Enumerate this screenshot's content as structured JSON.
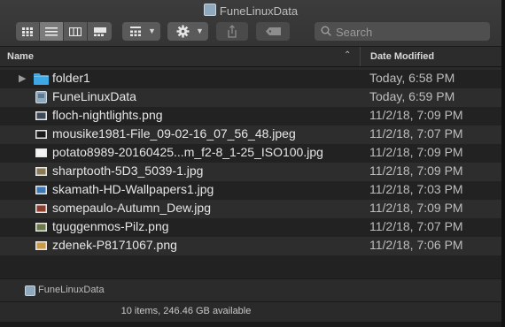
{
  "window": {
    "title": "FuneLinuxData"
  },
  "toolbar": {
    "view_modes": [
      "icon-view",
      "list-view",
      "column-view",
      "gallery-view"
    ],
    "active_view": "list-view",
    "group_menu_icon": "group-grid-icon",
    "action_menu_icon": "gear-icon",
    "share_icon": "share-icon",
    "tag_icon": "tag-icon",
    "search_placeholder": "Search"
  },
  "columns": {
    "name": "Name",
    "date": "Date Modified"
  },
  "files": [
    {
      "name": "folder1",
      "date": "Today, 6:58 PM",
      "kind": "folder"
    },
    {
      "name": "FuneLinuxData",
      "date": "Today, 6:59 PM",
      "kind": "app"
    },
    {
      "name": "floch-nightlights.png",
      "date": "11/2/18, 7:09 PM",
      "kind": "image"
    },
    {
      "name": "mousike1981-File_09-02-16_07_56_48.jpeg",
      "date": "11/2/18, 7:07 PM",
      "kind": "image"
    },
    {
      "name": "potato8989-20160425...m_f2-8_1-25_ISO100.jpg",
      "date": "11/2/18, 7:09 PM",
      "kind": "image"
    },
    {
      "name": "sharptooth-5D3_5039-1.jpg",
      "date": "11/2/18, 7:09 PM",
      "kind": "image"
    },
    {
      "name": "skamath-HD-Wallpapers1.jpg",
      "date": "11/2/18, 7:03 PM",
      "kind": "image"
    },
    {
      "name": "somepaulo-Autumn_Dew.jpg",
      "date": "11/2/18, 7:09 PM",
      "kind": "image"
    },
    {
      "name": "tguggenmos-Pilz.png",
      "date": "11/2/18, 7:07 PM",
      "kind": "image"
    },
    {
      "name": "zdenek-P8171067.png",
      "date": "11/2/18, 7:06 PM",
      "kind": "image"
    }
  ],
  "path_bar": {
    "label": "FuneLinuxData"
  },
  "status": {
    "text": "10 items, 246.46 GB available"
  },
  "colors": {
    "folder": "#3ea7e6",
    "background": "#2a2a2a",
    "row_alt": "#2d2d2d"
  }
}
